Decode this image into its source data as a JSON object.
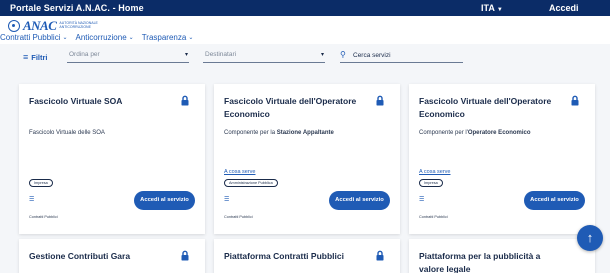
{
  "topbar": {
    "title": "Portale Servizi A.N.AC. - Home",
    "language": "ITA",
    "login": "Accedi"
  },
  "header": {
    "logo_mark": "ANAC",
    "logo_subtitle": "AUTORITÀ NAZIONALE ANTICORRUZIONE",
    "nav": [
      {
        "label": "Contratti Pubblici"
      },
      {
        "label": "Anticorruzione"
      },
      {
        "label": "Trasparenza"
      }
    ]
  },
  "filters": {
    "label": "Filtri",
    "order_placeholder": "Ordina per",
    "recipients_placeholder": "Destinatari",
    "search_placeholder": "Cerca servizi"
  },
  "cards": [
    {
      "title": "Fascicolo Virtuale SOA",
      "description": "Fascicolo Virtuale delle SOA",
      "desc_prefix": "",
      "desc_bold": "",
      "link": "",
      "badge": "Impresa",
      "button": "Accedi al servizio",
      "category": "Contratti Pubblici"
    },
    {
      "title": "Fascicolo Virtuale dell'Operatore Economico",
      "description": "",
      "desc_prefix": "Componente per la ",
      "desc_bold": "Stazione Appaltante",
      "link": "A cosa serve",
      "badge": "Amministrazione Pubblica",
      "button": "Accedi al servizio",
      "category": "Contratti Pubblici"
    },
    {
      "title": "Fascicolo Virtuale dell'Operatore Economico",
      "description": "",
      "desc_prefix": "Componente per l'",
      "desc_bold": "Operatore Economico",
      "link": "A cosa serve",
      "badge": "Impresa",
      "button": "Accedi al servizio",
      "category": "Contratti Pubblici"
    },
    {
      "title": "Gestione Contributi Gara"
    },
    {
      "title": "Piattaforma Contratti Pubblici"
    },
    {
      "title": "Piattaforma per la pubblicità a valore legale"
    }
  ],
  "icons": {
    "filter": "filter-icon",
    "search": "search-icon",
    "lock": "lock-icon",
    "tag": "tag-icon",
    "scroll_top": "arrow-up-icon"
  },
  "colors": {
    "topbar": "#0b2c67",
    "accent": "#1f5bb5",
    "background": "#f4f6f9"
  }
}
